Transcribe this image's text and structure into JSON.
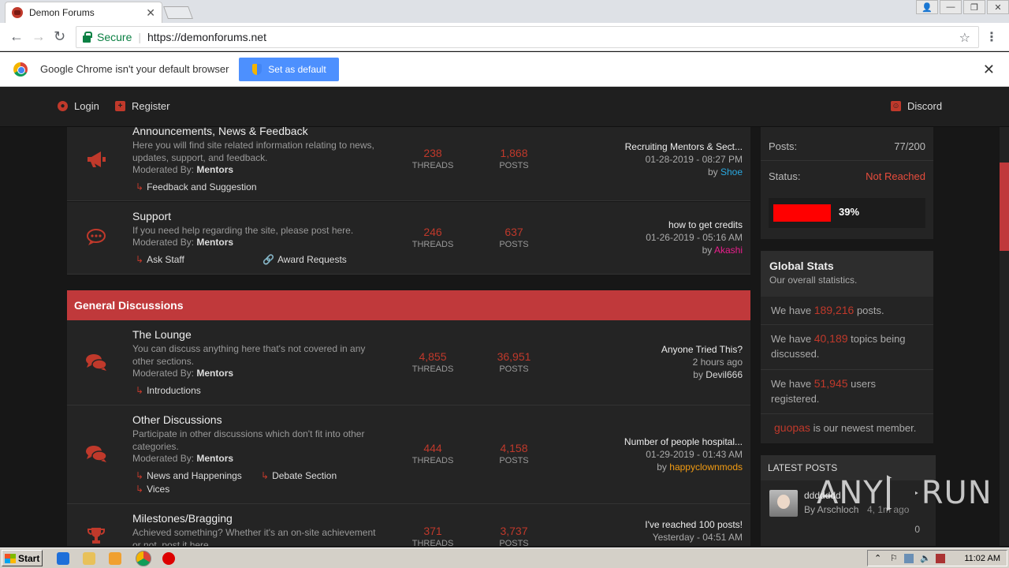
{
  "browser": {
    "tab_title": "Demon Forums",
    "secure_label": "Secure",
    "url": "https://demonforums.net"
  },
  "infobar": {
    "message": "Google Chrome isn't your default browser",
    "button": "Set as default"
  },
  "header": {
    "login": "Login",
    "register": "Register",
    "discord": "Discord"
  },
  "forums": {
    "announcements": {
      "name": "Announcements, News & Feedback",
      "desc": "Here you will find site related information relating to news, updates, support, and feedback.",
      "mod_prefix": "Moderated By:",
      "mod": "Mentors",
      "subforums": [
        "Feedback and Suggestion"
      ],
      "threads": "238",
      "posts": "1,868",
      "last_title": "Recruiting Mentors & Sect...",
      "last_date": "01-28-2019 - 08:27 PM",
      "last_by": "by",
      "last_user": "Shoe",
      "last_user_color": "#29a8e0"
    },
    "support": {
      "name": "Support",
      "desc": "If you need help regarding the site, please post here.",
      "mod_prefix": "Moderated By:",
      "mod": "Mentors",
      "subforums": [
        "Ask Staff",
        "Award Requests"
      ],
      "threads": "246",
      "posts": "637",
      "last_title": "how to get credits",
      "last_date": "01-26-2019 - 05:16 AM",
      "last_by": "by",
      "last_user": "Akashi",
      "last_user_color": "#e91e8c"
    },
    "category": "General Discussions",
    "lounge": {
      "name": "The Lounge",
      "desc": "You can discuss anything here that's not covered in any other sections.",
      "mod_prefix": "Moderated By:",
      "mod": "Mentors",
      "subforums": [
        "Introductions"
      ],
      "threads": "4,855",
      "posts": "36,951",
      "last_title": "Anyone Tried This?",
      "last_date": "2 hours ago",
      "last_by": "by",
      "last_user": "Devil666",
      "last_user_color": "#dddddd"
    },
    "other": {
      "name": "Other Discussions",
      "desc": "Participate in other discussions which don't fit into other categories.",
      "mod_prefix": "Moderated By:",
      "mod": "Mentors",
      "subforums": [
        "News and Happenings",
        "Debate Section",
        "Vices"
      ],
      "threads": "444",
      "posts": "4,158",
      "last_title": "Number of people hospital...",
      "last_date": "01-29-2019 - 01:43 AM",
      "last_by": "by",
      "last_user": "happyclownmods",
      "last_user_color": "#f39c12"
    },
    "milestones": {
      "name": "Milestones/Bragging",
      "desc": "Achieved something? Whether it's an on-site achievement or not, post it here.",
      "threads": "371",
      "posts": "3,737",
      "last_title": "I've reached 100 posts!",
      "last_date": "Yesterday - 04:51 AM"
    },
    "threads_label": "THREADS",
    "posts_label": "POSTS"
  },
  "sidebar": {
    "posts_label": "Posts:",
    "posts_value": "77/200",
    "status_label": "Status:",
    "status_value": "Not Reached",
    "progress_fraction": 0.39,
    "progress_text": "39%",
    "global_title": "Global Stats",
    "global_sub": "Our overall statistics.",
    "stat1_pre": "We have",
    "stat1_val": "189,216",
    "stat1_post": "posts.",
    "stat2_pre": "We have",
    "stat2_val": "40,189",
    "stat2_post": "topics being discussed.",
    "stat3_pre": "We have",
    "stat3_val": "51,945",
    "stat3_post": "users registered.",
    "newest_user": "guopas",
    "newest_text": "is our newest member.",
    "latest_title": "LATEST POSTS",
    "latest_post_title": "ddddddd",
    "latest_post_by": "By Arschloch",
    "latest_post_time": "4, 1m ago",
    "latest_post_count": "0"
  },
  "watermark": {
    "left": "ANY",
    "right": "RUN"
  },
  "taskbar": {
    "start": "Start",
    "time": "11:02 AM"
  }
}
